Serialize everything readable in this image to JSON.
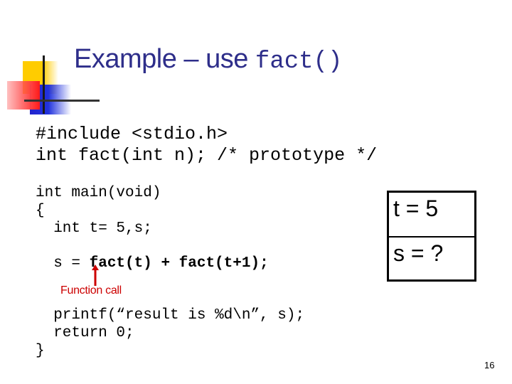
{
  "slide": {
    "title": {
      "text": "Example – use ",
      "code": "fact()"
    },
    "header_code": [
      "#include <stdio.h>",
      "int fact(int n); /* prototype */"
    ],
    "main_code": {
      "line1": "int main(void)",
      "line2": "{",
      "line3": "  int t= 5,s;",
      "line4_prefix": "  s = ",
      "line4_bold": "fact(t) + fact(t+1);",
      "line5": "  printf(“result is %d\\n”, s);",
      "line6": "  return 0;",
      "line7": "}"
    },
    "variables_box": [
      {
        "label": "t = 5"
      },
      {
        "label": "s = ?"
      }
    ],
    "annotation": {
      "text": "Function call",
      "color": "#cc0000",
      "icon": "up-arrow-icon"
    },
    "title_color": "#2e2e8a",
    "page_number": "16"
  }
}
